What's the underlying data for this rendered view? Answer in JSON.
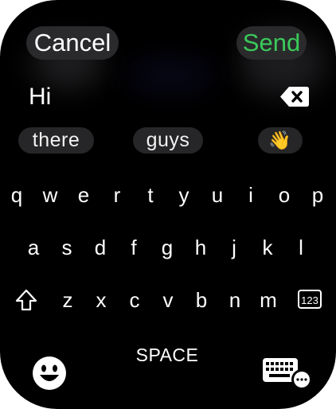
{
  "header": {
    "cancel_label": "Cancel",
    "send_label": "Send"
  },
  "input": {
    "text": "Hi"
  },
  "suggestions": [
    "there",
    "guys",
    "👋"
  ],
  "keyboard": {
    "row1": [
      "q",
      "w",
      "e",
      "r",
      "t",
      "y",
      "u",
      "i",
      "o",
      "p"
    ],
    "row2": [
      "a",
      "s",
      "d",
      "f",
      "g",
      "h",
      "j",
      "k",
      "l"
    ],
    "row3": [
      "z",
      "x",
      "c",
      "v",
      "b",
      "n",
      "m"
    ],
    "num_label": "123",
    "space_label": "SPACE"
  },
  "icons": [
    "backspace-icon",
    "shift-icon",
    "emoji-icon",
    "keyboard-chat-icon"
  ],
  "colors": {
    "background": "#000000",
    "send": "#3ac95a",
    "pill": "#2a2a2c"
  }
}
